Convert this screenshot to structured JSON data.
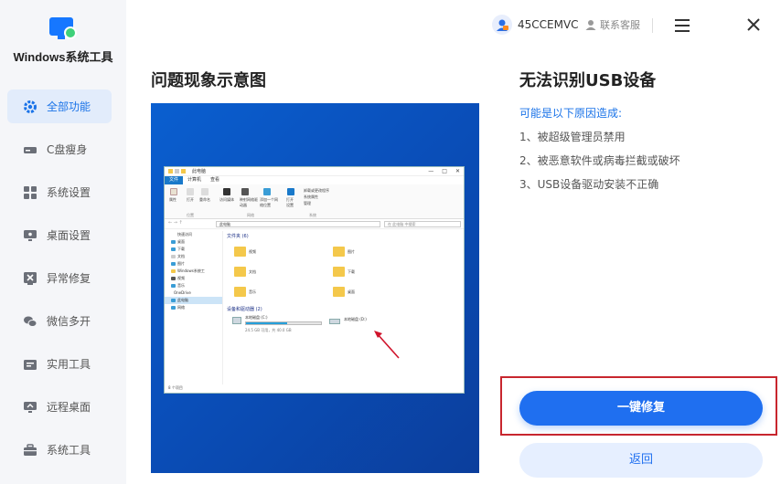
{
  "app": {
    "name": "Windows系统工具"
  },
  "sidebar": {
    "items": [
      {
        "label": "全部功能",
        "icon": "gear-icon",
        "active": true
      },
      {
        "label": "C盘瘦身",
        "icon": "disk-icon",
        "active": false
      },
      {
        "label": "系统设置",
        "icon": "grid-icon",
        "active": false
      },
      {
        "label": "桌面设置",
        "icon": "monitor-icon",
        "active": false
      },
      {
        "label": "异常修复",
        "icon": "repair-icon",
        "active": false
      },
      {
        "label": "微信多开",
        "icon": "wechat-icon",
        "active": false
      },
      {
        "label": "实用工具",
        "icon": "toolbox-icon",
        "active": false
      },
      {
        "label": "远程桌面",
        "icon": "remote-desktop-icon",
        "active": false
      },
      {
        "label": "系统工具",
        "icon": "briefcase-icon",
        "active": false
      }
    ]
  },
  "topbar": {
    "user_id": "45CCEMVC",
    "service_label": "联系客服"
  },
  "main": {
    "preview_title": "问题现象示意图",
    "explorer": {
      "title": "此电脑",
      "tabs": [
        "文件",
        "计算机",
        "查看"
      ],
      "ribbon": {
        "buttons": [
          "属性",
          "打开",
          "重命名",
          "访问媒体",
          "映射网络驱动器",
          "添加一个网络位置",
          "打开设置",
          "卸载或更改程序",
          "系统属性",
          "管理"
        ],
        "groups": [
          "位置",
          "网络",
          "系统"
        ]
      },
      "address": "此电脑",
      "search_placeholder": "在 此电脑 中搜索",
      "nav_pane": [
        "快速访问",
        "桌面",
        "下载",
        "文档",
        "图片",
        "Windows系统工",
        "视频",
        "音乐",
        "OneDrive",
        "此电脑",
        "网络"
      ],
      "folders_group": "文件夹 (6)",
      "folders": [
        "视频",
        "图片",
        "文档",
        "下载",
        "音乐",
        "桌面"
      ],
      "devices_group": "设备和驱动器 (2)",
      "drives": [
        {
          "name": "本地磁盘 (C:)",
          "detail": "24.5 GB 可用，共 40.0 GB",
          "used_fraction": 0.55
        },
        {
          "name": "本地磁盘 (D:)"
        }
      ],
      "status": "8 个项目"
    }
  },
  "panel": {
    "title": "无法识别USB设备",
    "subtitle": "可能是以下原因造成:",
    "reasons": [
      "1、被超级管理员禁用",
      "2、被恶意软件或病毒拦截或破坏",
      "3、USB设备驱动安装不正确"
    ],
    "fix_button": "一键修复",
    "back_button": "返回"
  },
  "colors": {
    "accent": "#1f6ff0",
    "highlight": "#c8262e",
    "sidebar_bg": "#f5f6f9",
    "active_bg": "#e2ecfb"
  }
}
